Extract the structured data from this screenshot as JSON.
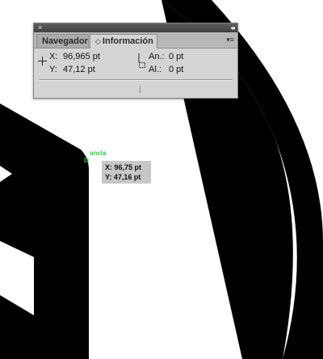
{
  "panel": {
    "close_icon": "×",
    "collapse_icon": "◂◂",
    "tabs": [
      {
        "label": "Navegador"
      },
      {
        "label": "Información",
        "active": true
      }
    ],
    "menu_icon": "▾≡",
    "position": {
      "x_label": "X:",
      "x_value": "96,965 pt",
      "y_label": "Y:",
      "y_value": "47,12 pt"
    },
    "size": {
      "w_label": "An.:",
      "w_value": "0 pt",
      "h_label": "Al.:",
      "h_value": "0 pt"
    }
  },
  "canvas": {
    "anchor_label": "ancla",
    "tooltip": {
      "x_line": "X: 96,75 pt",
      "y_line": "Y: 47,16 pt"
    }
  },
  "colors": {
    "anchor": "#2ecc40",
    "shape": "#000000",
    "panel_bg": "#d4d4d4"
  }
}
